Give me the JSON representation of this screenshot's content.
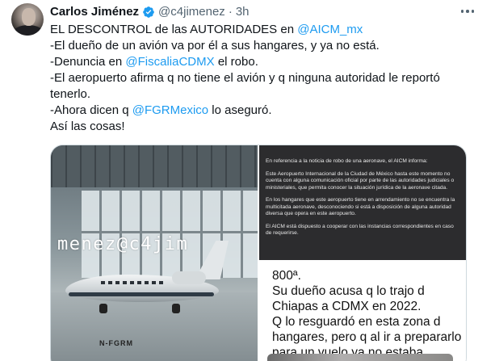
{
  "author": {
    "name": "Carlos Jiménez",
    "handle": "@c4jimenez",
    "separator": "·",
    "time": "3h",
    "verified_icon": "verified-badge-icon",
    "badge_color": "#1d9bf0"
  },
  "tweet": {
    "lines": [
      {
        "before": "EL DESCONTROL de las AUTORIDADES en ",
        "mention": "@AICM_mx",
        "after": ""
      },
      {
        "before": "-El dueño de un avión va por él a sus hangares, y ya no está.",
        "mention": "",
        "after": ""
      },
      {
        "before": "-Denuncia en ",
        "mention": "@FiscaliaCDMX",
        "after": " el robo."
      },
      {
        "before": "-El aeropuerto afirma q no tiene el avión y q ninguna autoridad le reportó",
        "mention": "",
        "after": ""
      },
      {
        "before": "tenerlo.",
        "mention": "",
        "after": ""
      },
      {
        "before": "-Ahora dicen q ",
        "mention": "@FGRMexico",
        "after": " lo aseguró."
      },
      {
        "before": "Así las cosas!",
        "mention": "",
        "after": ""
      }
    ]
  },
  "media": {
    "watermark": "menez@c4jim",
    "registration": "N-FGRM",
    "statement": [
      "En referencia a la noticia de robo de una aeronave, el AICM informa:",
      "Este Aeropuerto Internacional de la Ciudad de México hasta este momento no cuenta con alguna comunicación oficial por parte de las autoridades judiciales o ministeriales, que permita conocer la situación jurídica de la aeronave citada.",
      "En los hangares que este aeropuerto tiene en arrendamiento no se encuentra la multicitada aeronave, desconociendo si está a disposición de alguna autoridad diversa que opera en este aeropuerto.",
      "El AICM está dispuesto a cooperar con las instancias correspondientes en caso de requerirse."
    ],
    "caption_lines": [
      "800ª.",
      "Su dueño acusa q lo trajo d",
      "Chiapas a CDMX en 2022.",
      "Q lo resguardó en esta zona d",
      "hangares, pero q al ir a prepararlo",
      "para un vuelo ya no estaba."
    ]
  }
}
